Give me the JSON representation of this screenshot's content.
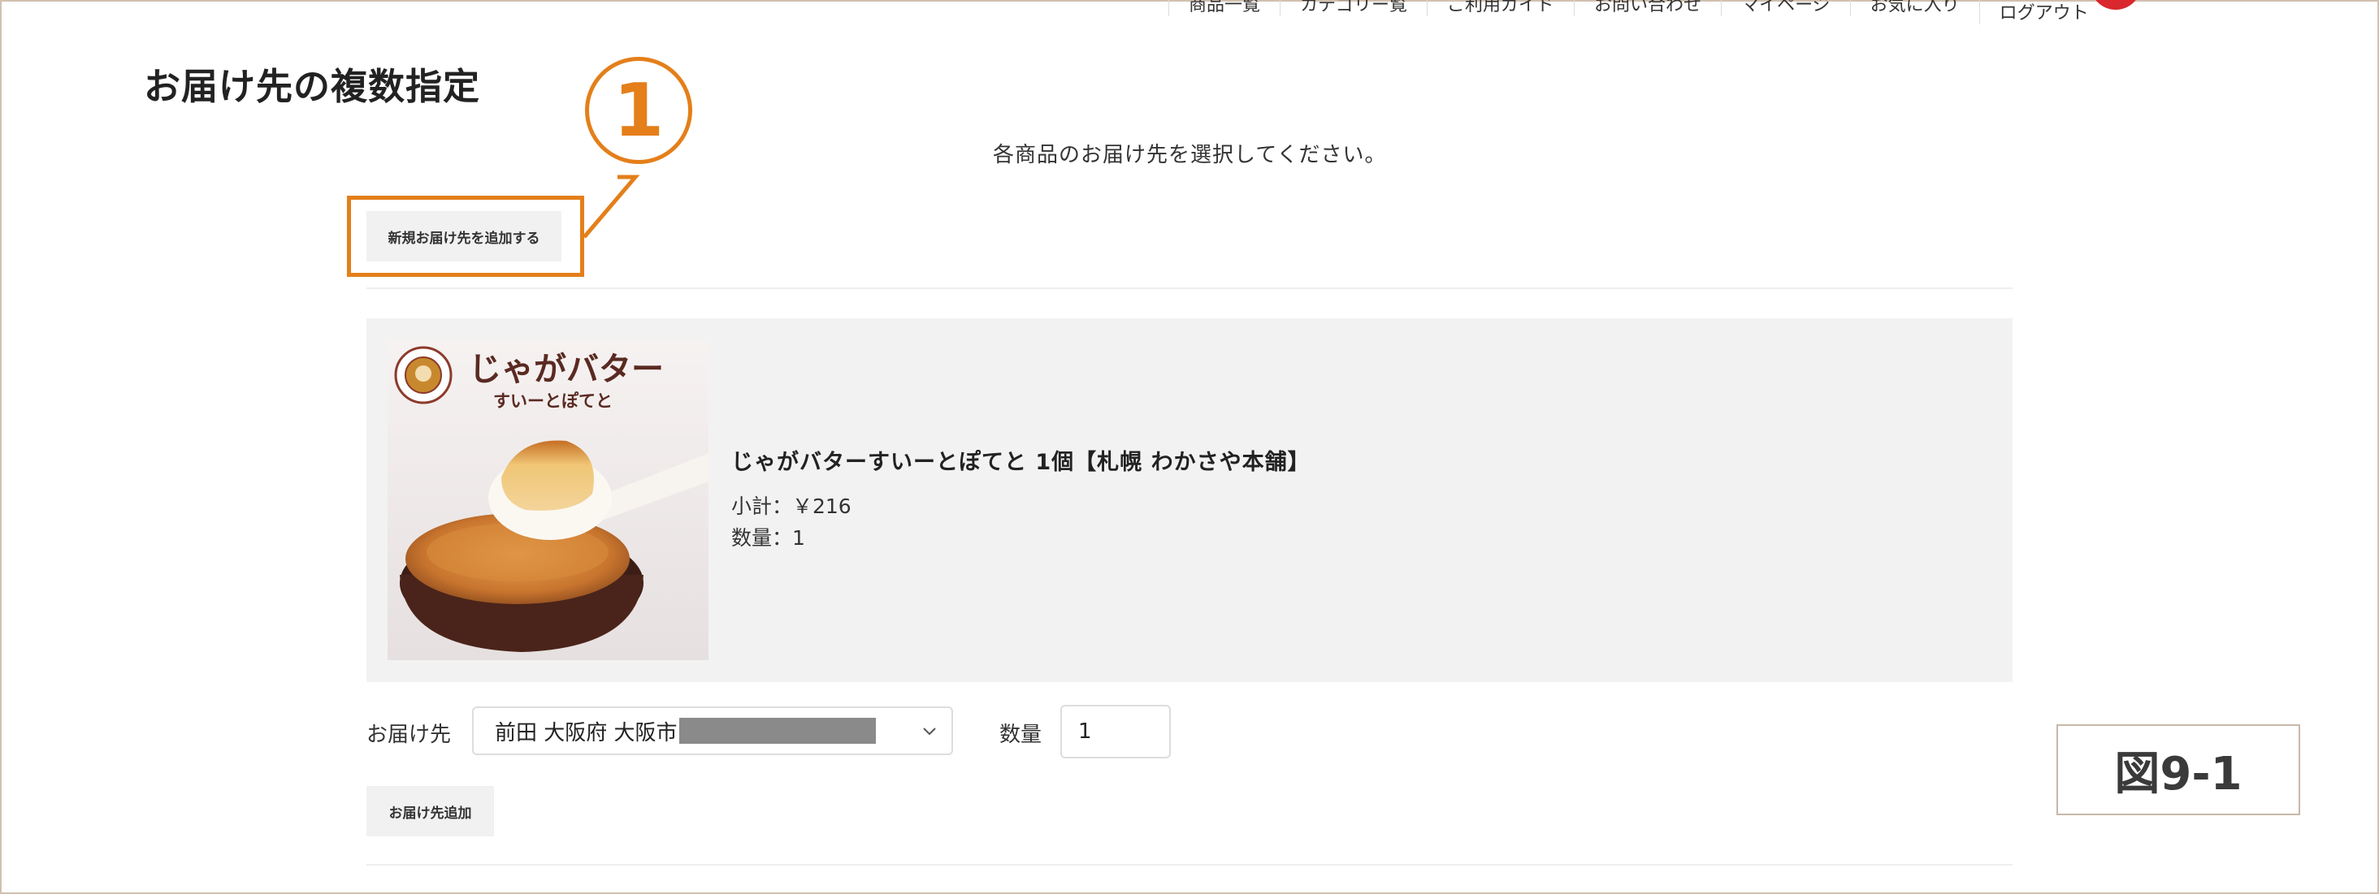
{
  "nav": {
    "items": [
      "商品一覧",
      "カテゴリー覧",
      "ご利用ガイド",
      "お問い合わせ",
      "マイページ",
      "お気に入り",
      "ログアウト"
    ]
  },
  "page": {
    "title": "お届け先の複数指定",
    "instruction": "各商品のお届け先を選択してください。",
    "new_address_button": "新規お届け先を追加する"
  },
  "annotation": {
    "number": "1",
    "figure_label": "図9-1",
    "color": "#e47f1a"
  },
  "product": {
    "image_title": "じゃがバター",
    "image_subtitle": "すいーとぽてと",
    "name": "じゃがバターすいーとぽてと 1個【札幌 わかさや本舗】",
    "subtotal": "小計：￥216",
    "quantity_text": "数量：1"
  },
  "delivery": {
    "label": "お届け先",
    "selected_address": "前田 大阪府 大阪市",
    "quantity_label": "数量",
    "quantity_value": "1",
    "add_button": "お届け先追加"
  }
}
